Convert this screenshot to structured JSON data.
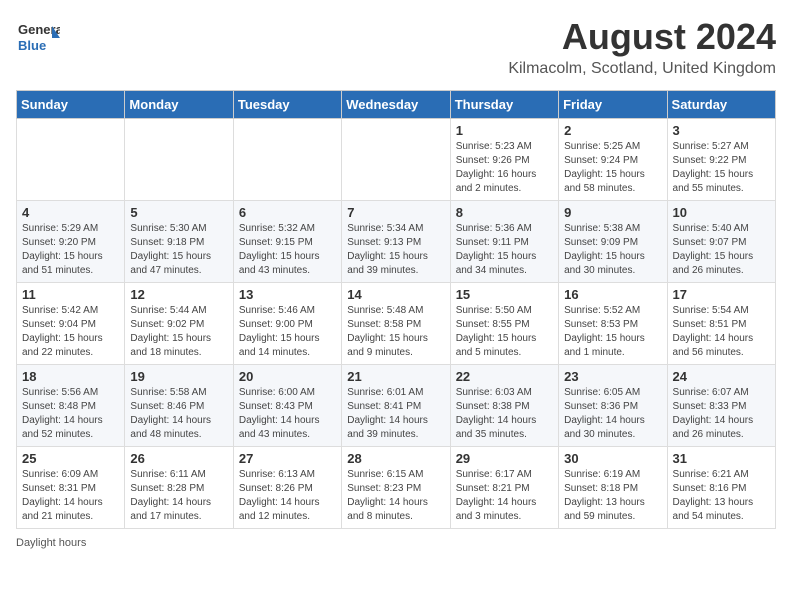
{
  "header": {
    "logo_general": "General",
    "logo_blue": "Blue",
    "month_year": "August 2024",
    "location": "Kilmacolm, Scotland, United Kingdom"
  },
  "weekdays": [
    "Sunday",
    "Monday",
    "Tuesday",
    "Wednesday",
    "Thursday",
    "Friday",
    "Saturday"
  ],
  "footer": {
    "daylight_hours": "Daylight hours"
  },
  "weeks": [
    [
      {
        "day": "",
        "info": ""
      },
      {
        "day": "",
        "info": ""
      },
      {
        "day": "",
        "info": ""
      },
      {
        "day": "",
        "info": ""
      },
      {
        "day": "1",
        "info": "Sunrise: 5:23 AM\nSunset: 9:26 PM\nDaylight: 16 hours and 2 minutes."
      },
      {
        "day": "2",
        "info": "Sunrise: 5:25 AM\nSunset: 9:24 PM\nDaylight: 15 hours and 58 minutes."
      },
      {
        "day": "3",
        "info": "Sunrise: 5:27 AM\nSunset: 9:22 PM\nDaylight: 15 hours and 55 minutes."
      }
    ],
    [
      {
        "day": "4",
        "info": "Sunrise: 5:29 AM\nSunset: 9:20 PM\nDaylight: 15 hours and 51 minutes."
      },
      {
        "day": "5",
        "info": "Sunrise: 5:30 AM\nSunset: 9:18 PM\nDaylight: 15 hours and 47 minutes."
      },
      {
        "day": "6",
        "info": "Sunrise: 5:32 AM\nSunset: 9:15 PM\nDaylight: 15 hours and 43 minutes."
      },
      {
        "day": "7",
        "info": "Sunrise: 5:34 AM\nSunset: 9:13 PM\nDaylight: 15 hours and 39 minutes."
      },
      {
        "day": "8",
        "info": "Sunrise: 5:36 AM\nSunset: 9:11 PM\nDaylight: 15 hours and 34 minutes."
      },
      {
        "day": "9",
        "info": "Sunrise: 5:38 AM\nSunset: 9:09 PM\nDaylight: 15 hours and 30 minutes."
      },
      {
        "day": "10",
        "info": "Sunrise: 5:40 AM\nSunset: 9:07 PM\nDaylight: 15 hours and 26 minutes."
      }
    ],
    [
      {
        "day": "11",
        "info": "Sunrise: 5:42 AM\nSunset: 9:04 PM\nDaylight: 15 hours and 22 minutes."
      },
      {
        "day": "12",
        "info": "Sunrise: 5:44 AM\nSunset: 9:02 PM\nDaylight: 15 hours and 18 minutes."
      },
      {
        "day": "13",
        "info": "Sunrise: 5:46 AM\nSunset: 9:00 PM\nDaylight: 15 hours and 14 minutes."
      },
      {
        "day": "14",
        "info": "Sunrise: 5:48 AM\nSunset: 8:58 PM\nDaylight: 15 hours and 9 minutes."
      },
      {
        "day": "15",
        "info": "Sunrise: 5:50 AM\nSunset: 8:55 PM\nDaylight: 15 hours and 5 minutes."
      },
      {
        "day": "16",
        "info": "Sunrise: 5:52 AM\nSunset: 8:53 PM\nDaylight: 15 hours and 1 minute."
      },
      {
        "day": "17",
        "info": "Sunrise: 5:54 AM\nSunset: 8:51 PM\nDaylight: 14 hours and 56 minutes."
      }
    ],
    [
      {
        "day": "18",
        "info": "Sunrise: 5:56 AM\nSunset: 8:48 PM\nDaylight: 14 hours and 52 minutes."
      },
      {
        "day": "19",
        "info": "Sunrise: 5:58 AM\nSunset: 8:46 PM\nDaylight: 14 hours and 48 minutes."
      },
      {
        "day": "20",
        "info": "Sunrise: 6:00 AM\nSunset: 8:43 PM\nDaylight: 14 hours and 43 minutes."
      },
      {
        "day": "21",
        "info": "Sunrise: 6:01 AM\nSunset: 8:41 PM\nDaylight: 14 hours and 39 minutes."
      },
      {
        "day": "22",
        "info": "Sunrise: 6:03 AM\nSunset: 8:38 PM\nDaylight: 14 hours and 35 minutes."
      },
      {
        "day": "23",
        "info": "Sunrise: 6:05 AM\nSunset: 8:36 PM\nDaylight: 14 hours and 30 minutes."
      },
      {
        "day": "24",
        "info": "Sunrise: 6:07 AM\nSunset: 8:33 PM\nDaylight: 14 hours and 26 minutes."
      }
    ],
    [
      {
        "day": "25",
        "info": "Sunrise: 6:09 AM\nSunset: 8:31 PM\nDaylight: 14 hours and 21 minutes."
      },
      {
        "day": "26",
        "info": "Sunrise: 6:11 AM\nSunset: 8:28 PM\nDaylight: 14 hours and 17 minutes."
      },
      {
        "day": "27",
        "info": "Sunrise: 6:13 AM\nSunset: 8:26 PM\nDaylight: 14 hours and 12 minutes."
      },
      {
        "day": "28",
        "info": "Sunrise: 6:15 AM\nSunset: 8:23 PM\nDaylight: 14 hours and 8 minutes."
      },
      {
        "day": "29",
        "info": "Sunrise: 6:17 AM\nSunset: 8:21 PM\nDaylight: 14 hours and 3 minutes."
      },
      {
        "day": "30",
        "info": "Sunrise: 6:19 AM\nSunset: 8:18 PM\nDaylight: 13 hours and 59 minutes."
      },
      {
        "day": "31",
        "info": "Sunrise: 6:21 AM\nSunset: 8:16 PM\nDaylight: 13 hours and 54 minutes."
      }
    ]
  ]
}
